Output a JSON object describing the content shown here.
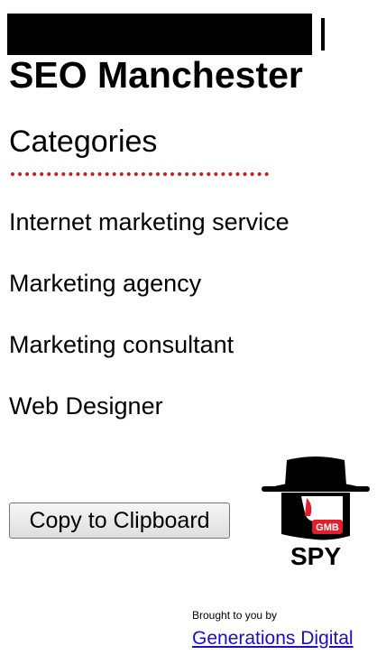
{
  "header": {
    "title": "SEO Manchester"
  },
  "categories": {
    "heading": "Categories",
    "items": [
      "Internet marketing service",
      "Marketing agency",
      "Marketing consultant",
      "Web Designer"
    ]
  },
  "actions": {
    "copy_label": "Copy to Clipboard"
  },
  "logo": {
    "badge_text": "GMB",
    "word_text": "SPY",
    "icon": "spy-hat-icon",
    "accent_color": "#e31e2b"
  },
  "footer": {
    "brought_by": "Brought to you by",
    "link_text": "Generations Digital",
    "link_color": "#1a0dcc"
  },
  "colors": {
    "divider": "#cc1a22",
    "text": "#000000",
    "background": "#ffffff"
  }
}
